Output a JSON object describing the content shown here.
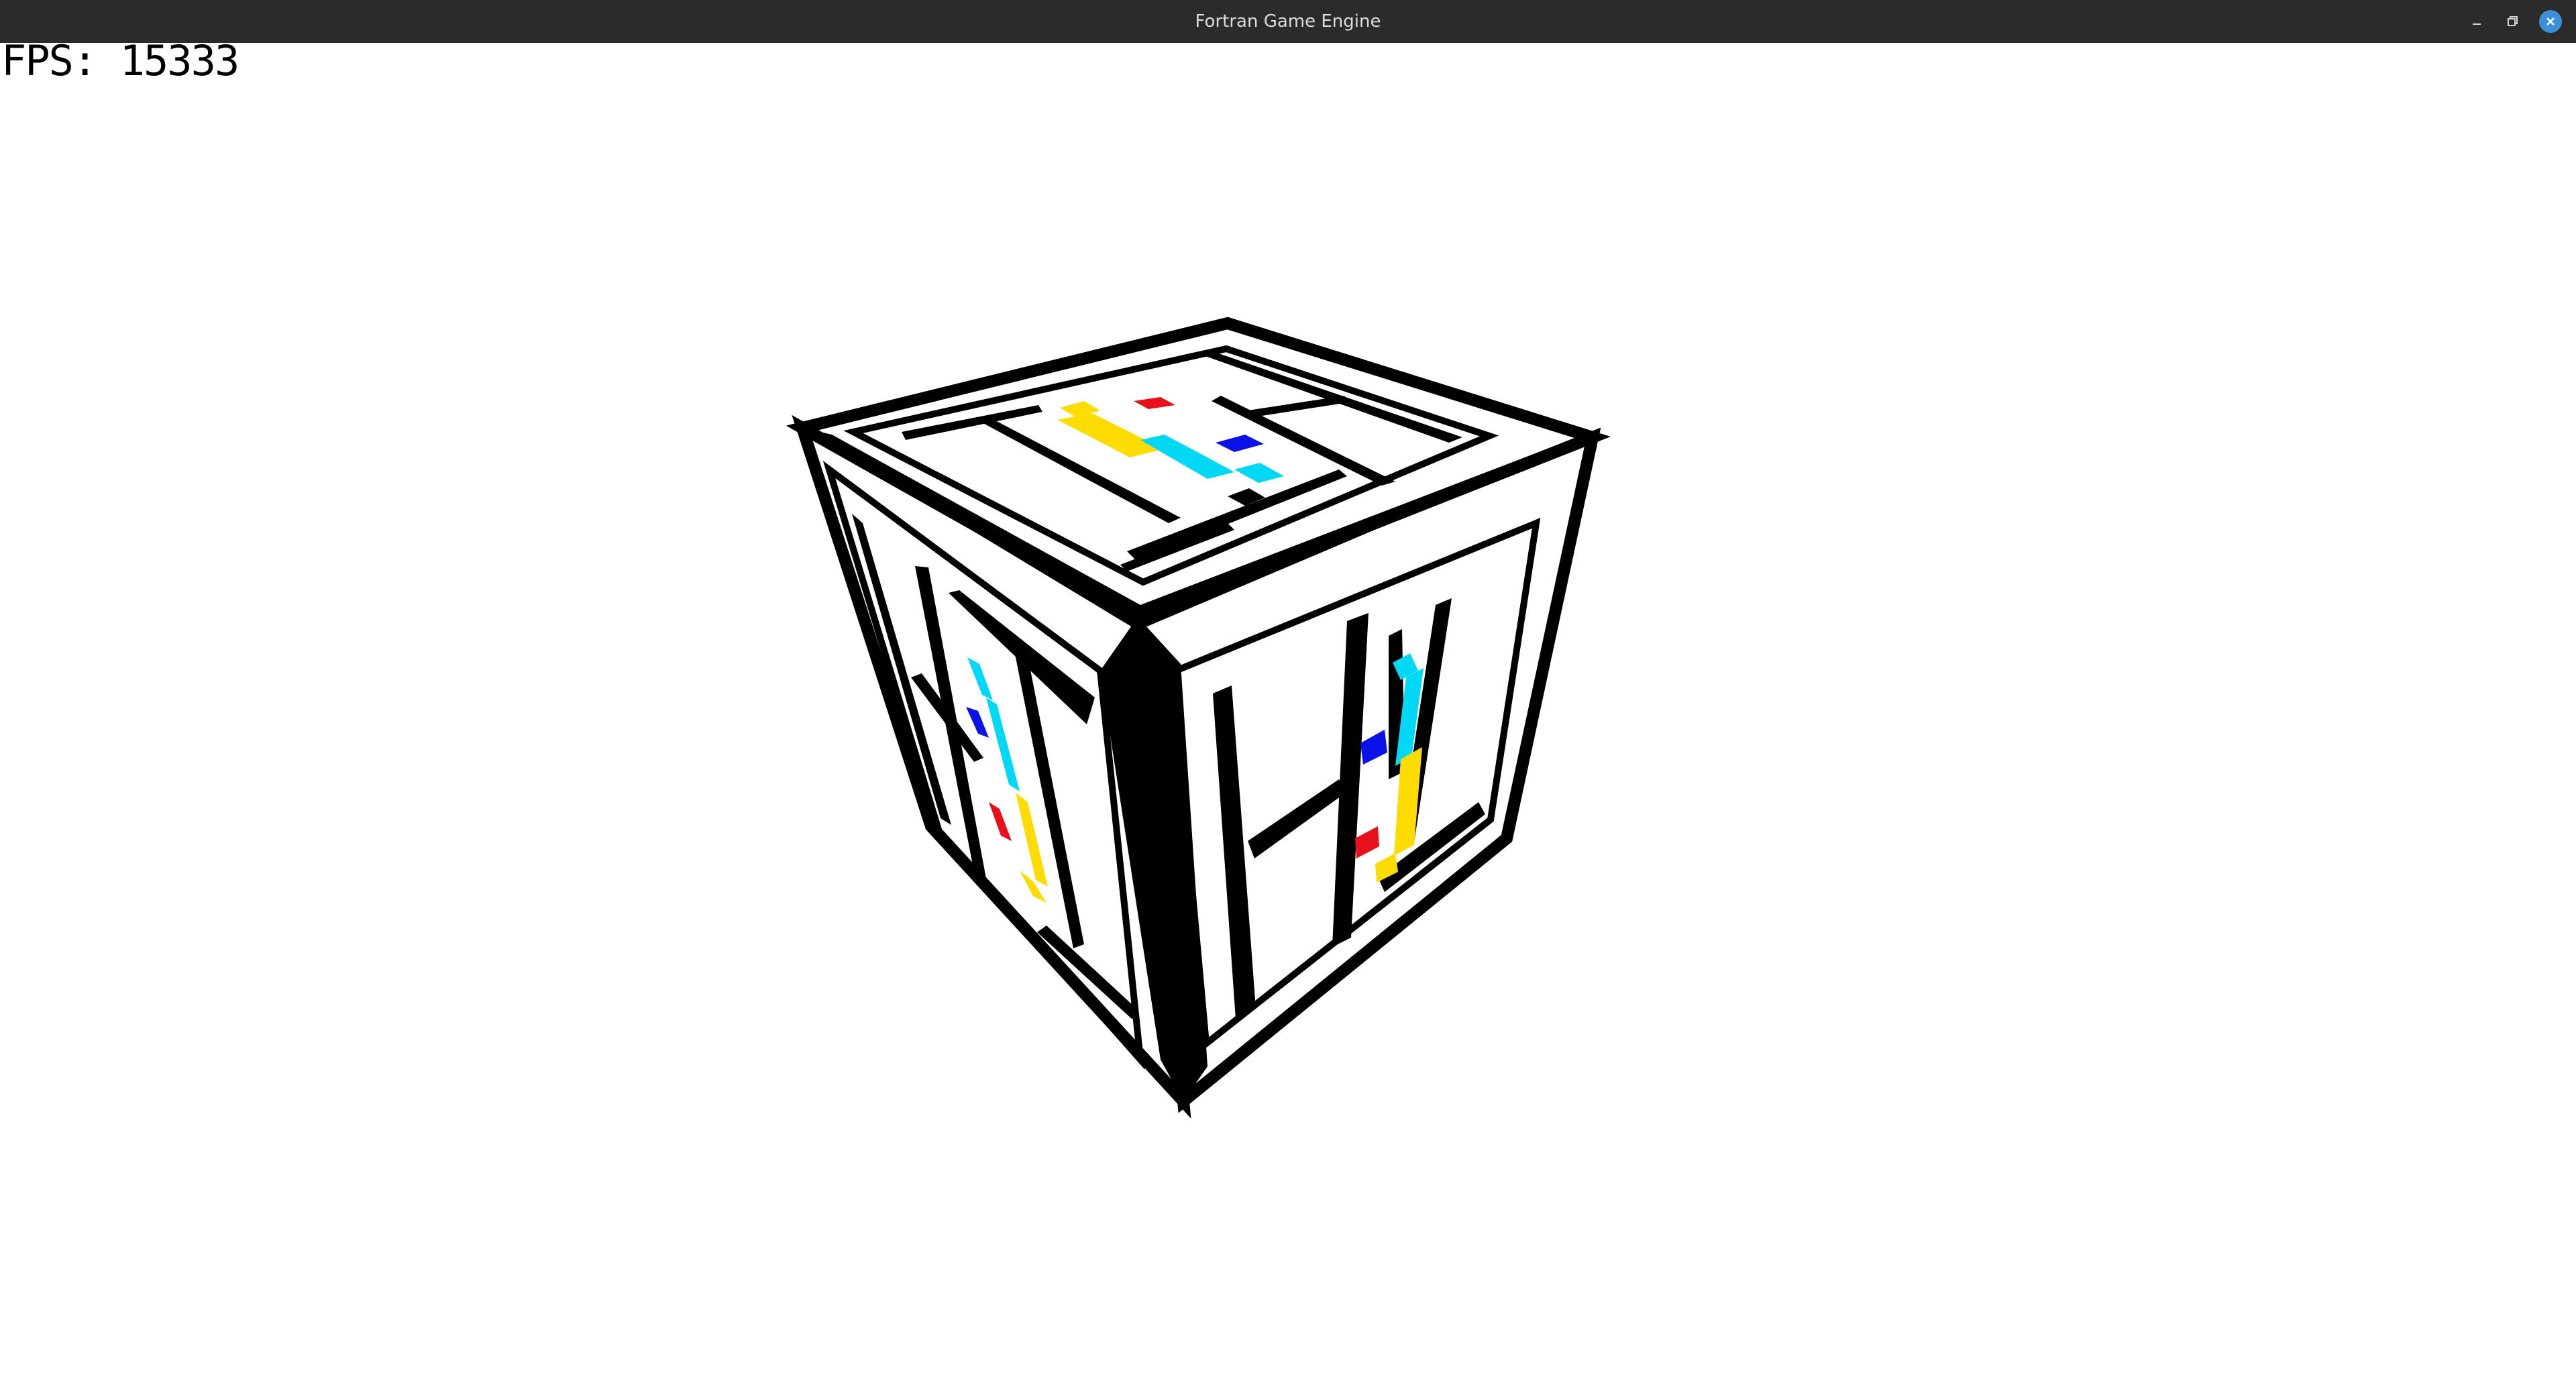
{
  "window": {
    "title": "Fortran Game Engine",
    "controls": {
      "minimize_icon": "minimize-icon",
      "maximize_icon": "restore-icon",
      "close_icon": "close-icon"
    },
    "titlebar_color": "#2b2b2b",
    "close_accent": "#3d8fd9"
  },
  "hud": {
    "fps_text": "FPS: 15333"
  },
  "scene": {
    "object": "cube",
    "face_letters": [
      "H",
      "I",
      "T"
    ],
    "background": "#ffffff",
    "colors": {
      "outline": "#000000",
      "cyan": "#00d8f5",
      "blue": "#0a12e8",
      "red": "#e8101a",
      "yellow": "#ffdc00"
    }
  }
}
